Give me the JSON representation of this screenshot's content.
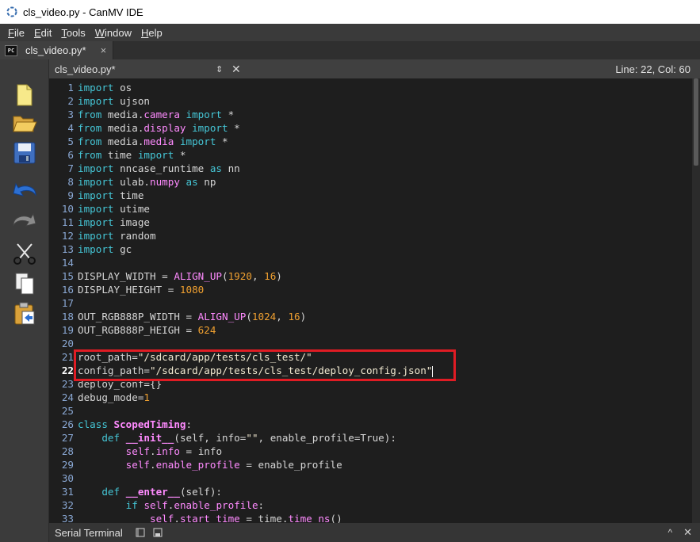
{
  "window": {
    "title": "cls_video.py - CanMV IDE"
  },
  "menu": [
    "File",
    "Edit",
    "Tools",
    "Window",
    "Help"
  ],
  "tab": {
    "icon_text": "PC",
    "label": "cls_video.py*",
    "close": "×"
  },
  "toolbar": [
    "new-file-icon",
    "open-folder-icon",
    "save-icon",
    "undo-icon",
    "redo-icon",
    "cut-icon",
    "copy-icon",
    "paste-icon"
  ],
  "editor_header": {
    "filename": "cls_video.py*",
    "updown": "⇕",
    "close": "✕",
    "cursor_position": "Line: 22, Col: 60"
  },
  "current_line": 22,
  "code": [
    [
      [
        "kw",
        "import"
      ],
      [
        "p",
        " os"
      ]
    ],
    [
      [
        "kw",
        "import"
      ],
      [
        "p",
        " ujson"
      ]
    ],
    [
      [
        "kw",
        "from"
      ],
      [
        "p",
        " media."
      ],
      [
        "md",
        "camera"
      ],
      [
        "p",
        " "
      ],
      [
        "kw",
        "import"
      ],
      [
        "p",
        " *"
      ]
    ],
    [
      [
        "kw",
        "from"
      ],
      [
        "p",
        " media."
      ],
      [
        "md",
        "display"
      ],
      [
        "p",
        " "
      ],
      [
        "kw",
        "import"
      ],
      [
        "p",
        " *"
      ]
    ],
    [
      [
        "kw",
        "from"
      ],
      [
        "p",
        " media."
      ],
      [
        "md",
        "media"
      ],
      [
        "p",
        " "
      ],
      [
        "kw",
        "import"
      ],
      [
        "p",
        " *"
      ]
    ],
    [
      [
        "kw",
        "from"
      ],
      [
        "p",
        " time "
      ],
      [
        "kw",
        "import"
      ],
      [
        "p",
        " *"
      ]
    ],
    [
      [
        "kw",
        "import"
      ],
      [
        "p",
        " nncase_runtime "
      ],
      [
        "kw",
        "as"
      ],
      [
        "p",
        " nn"
      ]
    ],
    [
      [
        "kw",
        "import"
      ],
      [
        "p",
        " ulab."
      ],
      [
        "md",
        "numpy"
      ],
      [
        "p",
        " "
      ],
      [
        "kw",
        "as"
      ],
      [
        "p",
        " np"
      ]
    ],
    [
      [
        "kw",
        "import"
      ],
      [
        "p",
        " time"
      ]
    ],
    [
      [
        "kw",
        "import"
      ],
      [
        "p",
        " utime"
      ]
    ],
    [
      [
        "kw",
        "import"
      ],
      [
        "p",
        " image"
      ]
    ],
    [
      [
        "kw",
        "import"
      ],
      [
        "p",
        " random"
      ]
    ],
    [
      [
        "kw",
        "import"
      ],
      [
        "p",
        " gc"
      ]
    ],
    [],
    [
      [
        "p",
        "DISPLAY_WIDTH = "
      ],
      [
        "fn",
        "ALIGN_UP"
      ],
      [
        "p",
        "("
      ],
      [
        "num",
        "1920"
      ],
      [
        "p",
        ", "
      ],
      [
        "num",
        "16"
      ],
      [
        "p",
        ")"
      ]
    ],
    [
      [
        "p",
        "DISPLAY_HEIGHT = "
      ],
      [
        "num",
        "1080"
      ]
    ],
    [],
    [
      [
        "p",
        "OUT_RGB888P_WIDTH = "
      ],
      [
        "fn",
        "ALIGN_UP"
      ],
      [
        "p",
        "("
      ],
      [
        "num",
        "1024"
      ],
      [
        "p",
        ", "
      ],
      [
        "num",
        "16"
      ],
      [
        "p",
        ")"
      ]
    ],
    [
      [
        "p",
        "OUT_RGB888P_HEIGH = "
      ],
      [
        "num",
        "624"
      ]
    ],
    [],
    [
      [
        "p",
        "root_path="
      ],
      [
        "str",
        "\"/sdcard/app/tests/cls_test/\""
      ]
    ],
    [
      [
        "p",
        "config_path="
      ],
      [
        "str",
        "\"/sdcard/app/tests/cls_test/deploy_config.json\""
      ]
    ],
    [
      [
        "p",
        "deploy_conf={}"
      ]
    ],
    [
      [
        "p",
        "debug_mode="
      ],
      [
        "num",
        "1"
      ]
    ],
    [],
    [
      [
        "kw",
        "class"
      ],
      [
        "p",
        " "
      ],
      [
        "cls",
        "ScopedTiming"
      ],
      [
        "p",
        ":"
      ]
    ],
    [
      [
        "p",
        "    "
      ],
      [
        "kw",
        "def"
      ],
      [
        "p",
        " "
      ],
      [
        "bi",
        "__init__"
      ],
      [
        "p",
        "(self, info="
      ],
      [
        "str",
        "\"\""
      ],
      [
        "p",
        ", enable_profile=True):"
      ]
    ],
    [
      [
        "p",
        "        "
      ],
      [
        "self",
        "self"
      ],
      [
        "p",
        "."
      ],
      [
        "md",
        "info"
      ],
      [
        "p",
        " = info"
      ]
    ],
    [
      [
        "p",
        "        "
      ],
      [
        "self",
        "self"
      ],
      [
        "p",
        "."
      ],
      [
        "md",
        "enable_profile"
      ],
      [
        "p",
        " = enable_profile"
      ]
    ],
    [],
    [
      [
        "p",
        "    "
      ],
      [
        "kw",
        "def"
      ],
      [
        "p",
        " "
      ],
      [
        "bi",
        "__enter__"
      ],
      [
        "p",
        "(self):"
      ]
    ],
    [
      [
        "p",
        "        "
      ],
      [
        "kw",
        "if"
      ],
      [
        "p",
        " "
      ],
      [
        "self",
        "self"
      ],
      [
        "p",
        "."
      ],
      [
        "md",
        "enable_profile"
      ],
      [
        "p",
        ":"
      ]
    ],
    [
      [
        "p",
        "            "
      ],
      [
        "self",
        "self"
      ],
      [
        "p",
        "."
      ],
      [
        "md",
        "start_time"
      ],
      [
        "p",
        " = time."
      ],
      [
        "md",
        "time_ns"
      ],
      [
        "p",
        "()"
      ]
    ]
  ],
  "bottom": {
    "label": "Serial Terminal",
    "up": "^",
    "close": "✕"
  }
}
